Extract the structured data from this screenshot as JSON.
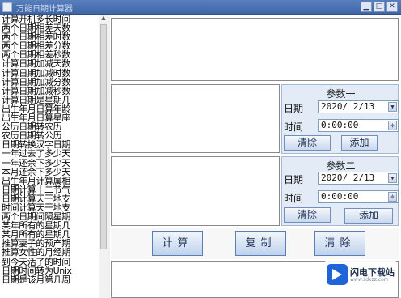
{
  "window": {
    "title": "万能日期计算器",
    "minimize_label": "▁",
    "maximize_label": "□",
    "close_label": "✕"
  },
  "function_list": [
    "计算开机多长时间",
    "两个日期相差天数",
    "两个日期相差时数",
    "两个日期相差分数",
    "两个日期相差秒数",
    "计算日期加减天数",
    "计算日期加减时数",
    "计算日期加减分数",
    "计算日期加减秒数",
    "计算日期是星期几",
    "出生年月日算年龄",
    "出生年月日算星座",
    "公历日期转农历",
    "农历日期转公历",
    "日期转换汉字日期",
    "一年过去了多少天",
    "一年还余下多少天",
    "本月还余下多少天",
    "出生年月计算属相",
    "日期计算十二节气",
    "日期计算天干地支",
    "时间计算天干地支",
    "两个日期间隔星期",
    "某年所有的星期几",
    "某月所有的星期几",
    "推算妻子的预产期",
    "推算女性的月经期",
    "到今天活了的时间",
    "日期时间转为Unix",
    "日期是该月第几周"
  ],
  "param1": {
    "title": "参数一",
    "date_label": "日期",
    "date_value": "2020/ 2/13",
    "time_label": "时间",
    "time_value": "0:00:00",
    "clear_label": "清除",
    "add_label": "添加"
  },
  "param2": {
    "title": "参数二",
    "date_label": "日期",
    "date_value": "2020/ 2/13",
    "time_label": "时间",
    "time_value": "0:00:00",
    "clear_label": "清除",
    "add_label": "添加"
  },
  "actions": {
    "calculate_label": "计算",
    "copy_label": "复制",
    "clear_label": "清除"
  },
  "watermark": {
    "name": "闪电下载站",
    "url": "www.sdxzz.com"
  },
  "icons": {
    "dropdown": "chevron-down-icon",
    "spinner": "spinner-icon"
  }
}
